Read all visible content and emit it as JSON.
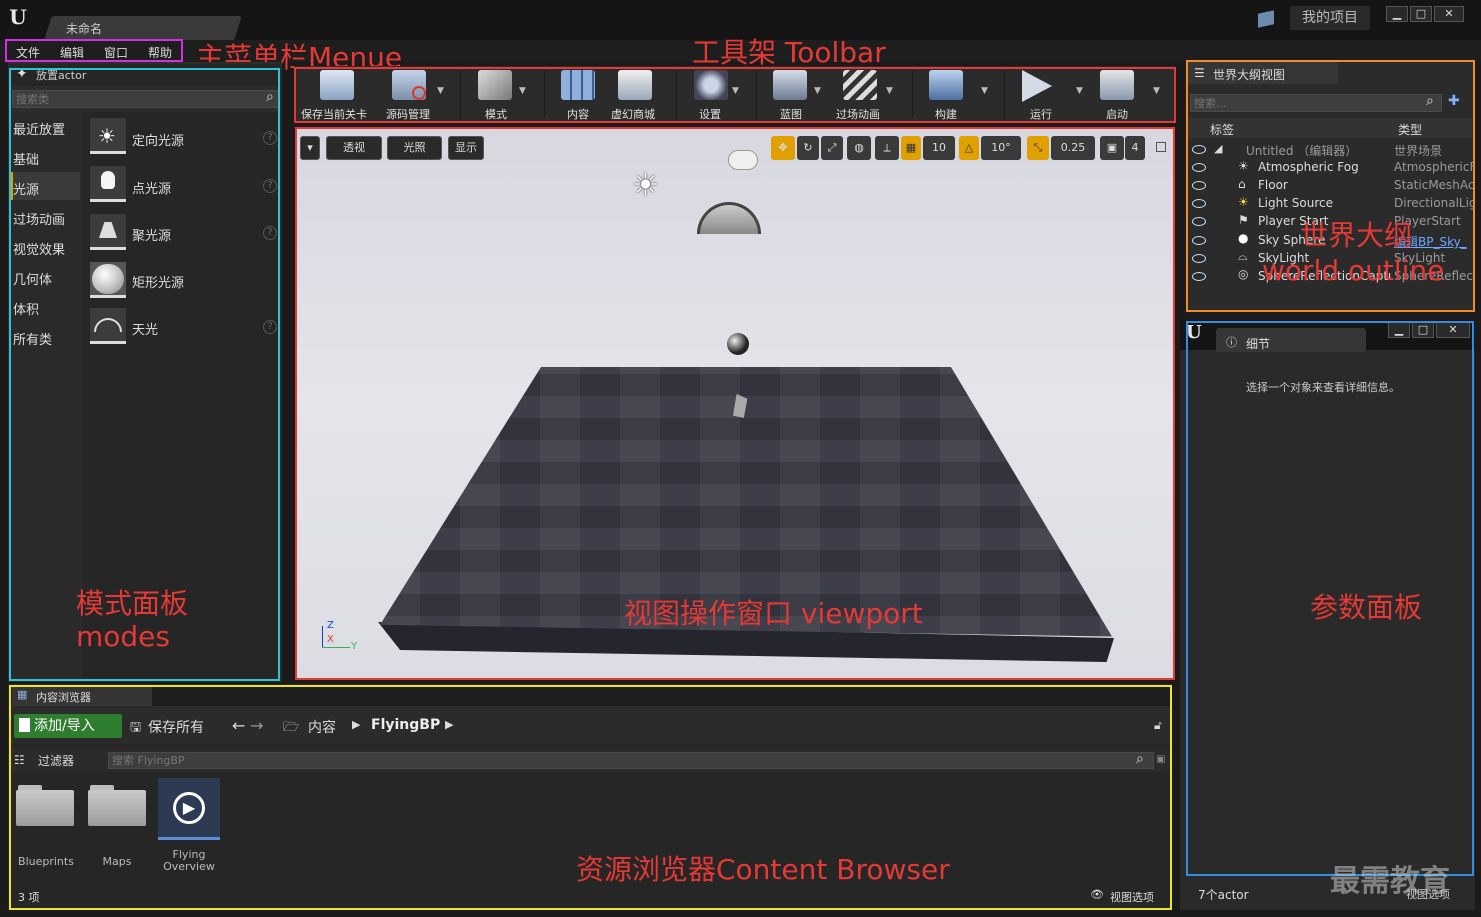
{
  "title_bar": {
    "doc_tab": "未命名",
    "project_button": "我的项目",
    "win_buttons": [
      "▁",
      "□",
      "✕"
    ]
  },
  "menu": {
    "items": [
      "文件",
      "编辑",
      "窗口",
      "帮助"
    ]
  },
  "annotations": {
    "menu": "主菜单栏Menue",
    "toolbar": "工具架 Toolbar",
    "outliner_cn": "世界大纲",
    "outliner_en": "world outline",
    "modes_cn": "模式面板",
    "modes_en": "modes",
    "viewport": "视图操作窗口 viewport",
    "details": "参数面板",
    "content_browser": "资源浏览器Content Browser",
    "watermark": "最需教育"
  },
  "modes": {
    "header": "放置actor",
    "search_placeholder": "搜索类",
    "categories": [
      "最近放置",
      "基础",
      "光源",
      "过场动画",
      "视觉效果",
      "几何体",
      "体积",
      "所有类"
    ],
    "selected_category": "光源",
    "items": [
      {
        "label": "定向光源",
        "icon": "directional-light-icon"
      },
      {
        "label": "点光源",
        "icon": "point-light-icon"
      },
      {
        "label": "聚光源",
        "icon": "spot-light-icon"
      },
      {
        "label": "矩形光源",
        "icon": "rect-light-icon"
      },
      {
        "label": "天光",
        "icon": "sky-light-icon"
      }
    ],
    "help_glyph": "?"
  },
  "toolbar": {
    "buttons": [
      {
        "label": "保存当前关卡",
        "icon": "save-icon"
      },
      {
        "label": "源码管理",
        "icon": "source-control-icon"
      },
      {
        "label": "模式",
        "icon": "modes-icon"
      },
      {
        "label": "内容",
        "icon": "content-icon"
      },
      {
        "label": "虚幻商城",
        "icon": "marketplace-icon"
      },
      {
        "label": "设置",
        "icon": "settings-icon"
      },
      {
        "label": "蓝图",
        "icon": "blueprint-icon"
      },
      {
        "label": "过场动画",
        "icon": "cinematics-icon"
      },
      {
        "label": "构建",
        "icon": "build-icon"
      },
      {
        "label": "运行",
        "icon": "play-icon"
      },
      {
        "label": "启动",
        "icon": "launch-icon"
      }
    ]
  },
  "viewport": {
    "buttons": {
      "menu": "▾",
      "perspective": "透视",
      "lit": "光照",
      "show": "显示"
    },
    "grid_snap": "10",
    "rotation_snap": "10°",
    "scale_snap": "0.25",
    "camera_speed": "4",
    "axes": {
      "z": "Z",
      "x": "X",
      "y": "Y"
    }
  },
  "outliner": {
    "tab": "世界大纲视图",
    "search_placeholder": "搜索...",
    "columns": {
      "label": "标签",
      "type": "类型"
    },
    "rows": [
      {
        "name": "Untitled （编辑器）",
        "type": "世界场景"
      },
      {
        "name": "Atmospheric Fog",
        "type": "AtmosphericF"
      },
      {
        "name": "Floor",
        "type": "StaticMeshAc"
      },
      {
        "name": "Light Source",
        "type": "DirectionalLig"
      },
      {
        "name": "Player Start",
        "type": "PlayerStart"
      },
      {
        "name": "Sky Sphere",
        "type": "编辑BP_Sky_"
      },
      {
        "name": "SkyLight",
        "type": "SkyLight"
      },
      {
        "name": "SphereReflectionCapture",
        "type": "SphereReflect"
      }
    ],
    "actor_count": "7个actor",
    "view_options": "视图选项"
  },
  "details": {
    "tab": "细节",
    "empty_message": "选择一个对象来查看详细信息。"
  },
  "content_browser": {
    "tab": "内容浏览器",
    "add_import": "添加/导入",
    "save_all": "保存所有",
    "path": [
      "内容",
      "FlyingBP"
    ],
    "filters": "过滤器",
    "search_placeholder": "搜索 FlyingBP",
    "assets": [
      {
        "label": "Blueprints",
        "icon": "folder-icon"
      },
      {
        "label": "Maps",
        "icon": "folder-icon"
      },
      {
        "label": "Flying\nOverview",
        "icon": "level-icon"
      }
    ],
    "item_count": "3 项",
    "view_options": "视图选项"
  },
  "colors": {
    "menu_box": "#d42fe0",
    "toolbar_box": "#e53935",
    "outliner_box": "#f28c28",
    "modes_box": "#2ec4d6",
    "details_box": "#2f8fe0",
    "cb_box": "#f2e22a",
    "annotation_text": "#e53935"
  }
}
